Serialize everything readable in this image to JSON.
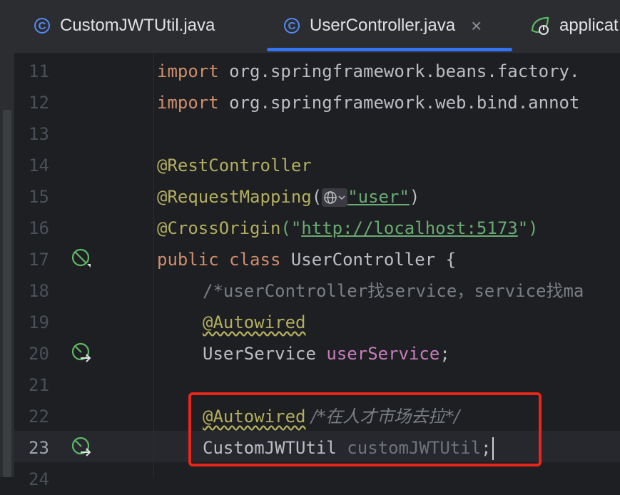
{
  "tabs": [
    {
      "label": "CustomJWTUtil.java",
      "icon": "class-icon",
      "active": false
    },
    {
      "label": "UserController.java",
      "icon": "class-icon",
      "active": true,
      "close": "×"
    },
    {
      "label": "applicat",
      "icon": "spring-config-icon",
      "active": false
    }
  ],
  "gutter": {
    "line_numbers": [
      "11",
      "12",
      "13",
      "14",
      "15",
      "16",
      "17",
      "18",
      "19",
      "20",
      "21",
      "22",
      "23",
      "24"
    ],
    "current_line": "23"
  },
  "code": {
    "l11": {
      "kw": "import",
      "rest": " org.springframework.beans.factory."
    },
    "l12": {
      "kw": "import",
      "rest": " org.springframework.web.bind.annot"
    },
    "l14": {
      "ann": "@RestController"
    },
    "l15": {
      "ann": "@RequestMapping",
      "open": "(",
      "str": "\"user\"",
      "close": ")"
    },
    "l16": {
      "ann": "@CrossOrigin",
      "open": "(\"",
      "link": "http://localhost:5173",
      "close": "\")"
    },
    "l17": {
      "kw1": "public",
      "kw2": "class",
      "name": " UserController {"
    },
    "l18": {
      "cmt": "/*userController找service，service找ma"
    },
    "l19": {
      "ann": "@Autowired"
    },
    "l20": {
      "type": "UserService ",
      "field": "userService",
      "semi": ";"
    },
    "l22": {
      "ann": "@Autowired",
      "cmt": " /*在人才市场去拉*/"
    },
    "l23": {
      "type": "CustomJWTUtil ",
      "field": "customJWTUtil",
      "semi": ";"
    }
  },
  "colors": {
    "accent": "#3574f0",
    "highlight_box": "#e8261c",
    "keyword": "#cf8e6d",
    "annotation": "#b3ae60",
    "string": "#6aab73",
    "field": "#c77dbb"
  }
}
